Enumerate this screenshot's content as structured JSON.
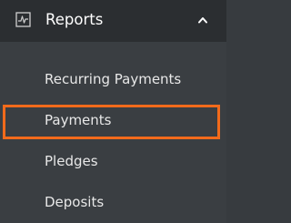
{
  "reports_section": {
    "title": "Reports",
    "icon": "activity-chart-icon",
    "expanded": true,
    "chevron_icon": "chevron-up-icon",
    "items": [
      {
        "label": "Recurring Payments"
      },
      {
        "label": "Payments",
        "highlighted": true
      },
      {
        "label": "Pledges"
      },
      {
        "label": "Deposits"
      }
    ]
  },
  "colors": {
    "header_background": "#2b2e31",
    "menu_background": "#3a3e42",
    "text": "#e8e8e8",
    "highlight": "#f26a1b"
  }
}
